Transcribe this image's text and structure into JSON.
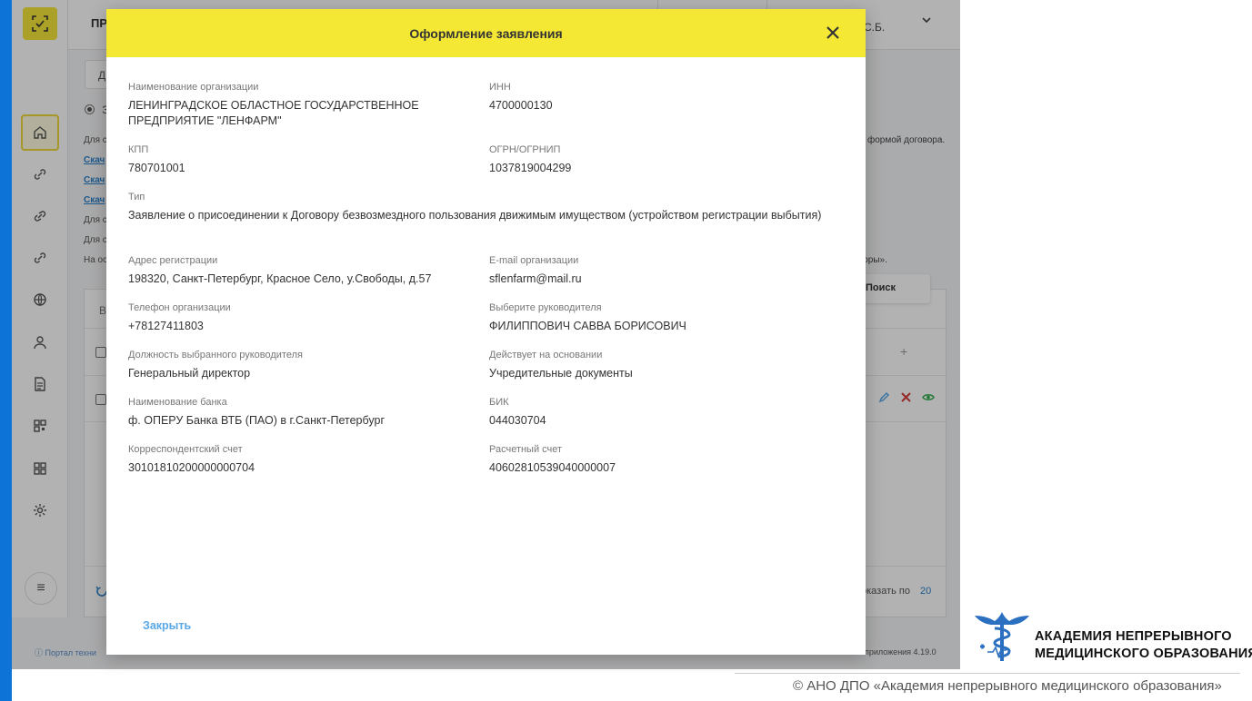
{
  "app": {
    "header_title": "ПР",
    "user_name": "С.Б.",
    "crumb_tab": "Д",
    "radio_label": "З",
    "bg_lines": [
      "Для с",
      "Скач",
      "Скач",
      "Скач",
      "Для с",
      "Для с",
      "На ос"
    ],
    "bg_right_1": "формой договора.",
    "bg_right_2": "воры».",
    "search_button": "Поиск",
    "table_header_letter": "В",
    "show_by_label": "оказать по",
    "show_by_value": "20",
    "help_text": "Портал техни",
    "version_text": "приложения 4.19.0"
  },
  "modal": {
    "title": "Оформление заявления",
    "close_button": "Закрыть",
    "fields": {
      "org_name": {
        "label": "Наименование организации",
        "value": "ЛЕНИНГРАДСКОЕ ОБЛАСТНОЕ ГОСУДАРСТВЕННОЕ ПРЕДПРИЯТИЕ \"ЛЕНФАРМ\""
      },
      "inn": {
        "label": "ИНН",
        "value": "4700000130"
      },
      "kpp": {
        "label": "КПП",
        "value": "780701001"
      },
      "ogrn": {
        "label": "ОГРН/ОГРНИП",
        "value": "1037819004299"
      },
      "type": {
        "label": "Тип",
        "value": "Заявление о присоединении к Договору безвозмездного пользования движимым имуществом (устройством регистрации выбытия)"
      },
      "address": {
        "label": "Адрес регистрации",
        "value": "198320, Санкт-Петербург, Красное Село, у.Свободы, д.57"
      },
      "email": {
        "label": "E-mail организации",
        "value": "sflenfarm@mail.ru"
      },
      "phone": {
        "label": "Телефон организации",
        "value": "+78127411803"
      },
      "head": {
        "label": "Выберите руководителя",
        "value": "ФИЛИППОВИЧ САВВА БОРИСОВИЧ"
      },
      "position": {
        "label": "Должность выбранного руководителя",
        "value": "Генеральный директор"
      },
      "basis": {
        "label": "Действует на основании",
        "value": "Учредительные документы"
      },
      "bank": {
        "label": "Наименование банка",
        "value": "ф. ОПЕРУ Банка ВТБ (ПАО) в г.Санкт-Петербург"
      },
      "bik": {
        "label": "БИК",
        "value": "044030704"
      },
      "corr_account": {
        "label": "Корреспондентский счет",
        "value": "30101810200000000704"
      },
      "account": {
        "label": "Расчетный счет",
        "value": "40602810539040000007"
      }
    }
  },
  "branding": {
    "line1": "АКАДЕМИЯ НЕПРЕРЫВНОГО",
    "line2": "МЕДИЦИНСКОГО ОБРАЗОВАНИЯ",
    "copyright": "© АНО ДПО «Академия непрерывного медицинского образования»"
  },
  "colors": {
    "accent_yellow": "#f5e835",
    "link_blue": "#5aa7e6",
    "stripe_blue": "#0d73d6"
  }
}
